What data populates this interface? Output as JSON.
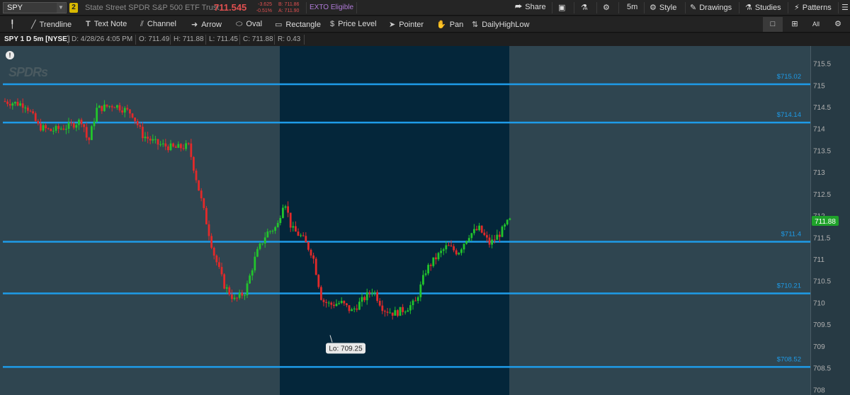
{
  "topbar": {
    "symbol": "SPY",
    "link_group": "2",
    "security_name": "State Street SPDR S&P 500 ETF Trust",
    "last_price": "711.545",
    "net_change": "-3.625",
    "percent_change": "-0.51%",
    "bid": "B: 711.86",
    "ask": "A: 711.90",
    "exto": "EXTO Eligible",
    "share": "Share",
    "period": "5m",
    "style": "Style",
    "drawings": "Drawings",
    "studies": "Studies",
    "patterns": "Patterns"
  },
  "toolbar": {
    "tools": [
      "Trendline",
      "Text Note",
      "Channel",
      "Arrow",
      "Oval",
      "Rectangle",
      "Price Level",
      "Pointer",
      "Pan",
      "DailyHighLow"
    ],
    "all_label": "All"
  },
  "info": {
    "title": "SPY 1 D 5m [NYSE]",
    "date": "D: 4/28/26 4:05 PM",
    "open": "O: 711.49",
    "high": "H: 711.88",
    "low": "L: 711.45",
    "close": "C: 711.88",
    "range": "R: 0.43"
  },
  "chart": {
    "watermark": "SPDRs",
    "colors": {
      "up": "#22c42c",
      "down": "#e22a2a",
      "level": "#1e9be8",
      "bg": "#2f4550",
      "session_bg": "#04263a",
      "axis_bg": "#273a44"
    },
    "y_range": [
      707.875,
      715.9
    ],
    "y_ticks": [
      715.5,
      715,
      714.5,
      714,
      713.5,
      713,
      712.5,
      712,
      711.5,
      711,
      710.5,
      710,
      709.5,
      709,
      708.5,
      708
    ],
    "price_levels": [
      {
        "value": 715.02,
        "label": "$715.02"
      },
      {
        "value": 714.14,
        "label": "$714.14"
      },
      {
        "value": 711.4,
        "label": "$711.4"
      },
      {
        "value": 710.21,
        "label": "$710.21"
      },
      {
        "value": 708.52,
        "label": "$708.52"
      }
    ],
    "low_label": "Lo: 709.25",
    "last_label": "711.88",
    "last_value": 711.88
  }
}
